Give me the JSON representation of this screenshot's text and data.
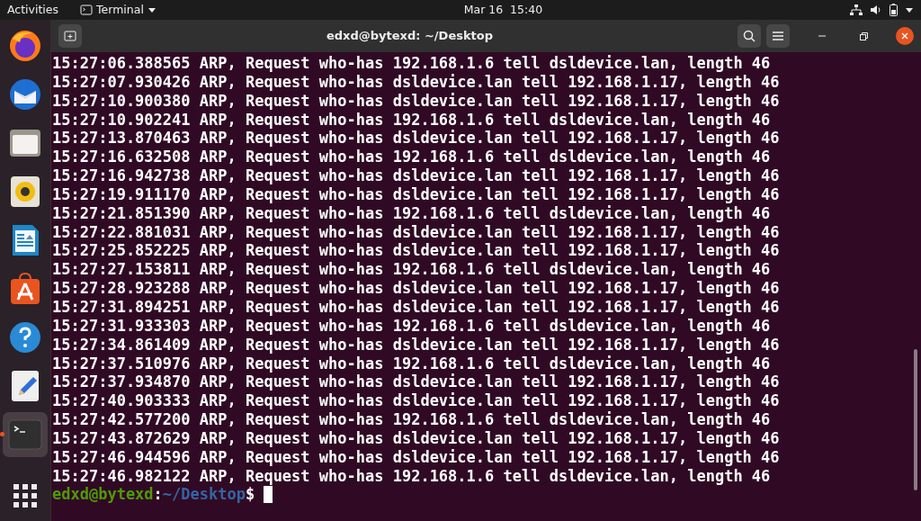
{
  "top_bar": {
    "activities": "Activities",
    "app_menu": "Terminal",
    "clock": "Mar 16  15:40"
  },
  "dock": {
    "items": [
      {
        "kind": "firefox",
        "selected": false,
        "running": false
      },
      {
        "kind": "mail",
        "selected": false,
        "running": false
      },
      {
        "kind": "files",
        "selected": false,
        "running": false
      },
      {
        "kind": "music",
        "selected": false,
        "running": false
      },
      {
        "kind": "document",
        "selected": false,
        "running": false
      },
      {
        "kind": "store",
        "selected": false,
        "running": false
      },
      {
        "kind": "help",
        "selected": false,
        "running": false
      },
      {
        "kind": "editor",
        "selected": false,
        "running": false
      },
      {
        "kind": "terminal",
        "selected": true,
        "running": true
      },
      {
        "kind": "grid",
        "selected": false,
        "running": false
      }
    ]
  },
  "window": {
    "title": "edxd@bytexd: ~/Desktop"
  },
  "terminal": {
    "lines": [
      "15:27:06.388565 ARP, Request who-has 192.168.1.6 tell dsldevice.lan, length 46",
      "15:27:07.930426 ARP, Request who-has dsldevice.lan tell 192.168.1.17, length 46",
      "15:27:10.900380 ARP, Request who-has dsldevice.lan tell 192.168.1.17, length 46",
      "15:27:10.902241 ARP, Request who-has 192.168.1.6 tell dsldevice.lan, length 46",
      "15:27:13.870463 ARP, Request who-has dsldevice.lan tell 192.168.1.17, length 46",
      "15:27:16.632508 ARP, Request who-has 192.168.1.6 tell dsldevice.lan, length 46",
      "15:27:16.942738 ARP, Request who-has dsldevice.lan tell 192.168.1.17, length 46",
      "15:27:19.911170 ARP, Request who-has dsldevice.lan tell 192.168.1.17, length 46",
      "15:27:21.851390 ARP, Request who-has 192.168.1.6 tell dsldevice.lan, length 46",
      "15:27:22.881031 ARP, Request who-has dsldevice.lan tell 192.168.1.17, length 46",
      "15:27:25.852225 ARP, Request who-has dsldevice.lan tell 192.168.1.17, length 46",
      "15:27:27.153811 ARP, Request who-has 192.168.1.6 tell dsldevice.lan, length 46",
      "15:27:28.923288 ARP, Request who-has dsldevice.lan tell 192.168.1.17, length 46",
      "15:27:31.894251 ARP, Request who-has dsldevice.lan tell 192.168.1.17, length 46",
      "15:27:31.933303 ARP, Request who-has 192.168.1.6 tell dsldevice.lan, length 46",
      "15:27:34.861409 ARP, Request who-has dsldevice.lan tell 192.168.1.17, length 46",
      "15:27:37.510976 ARP, Request who-has 192.168.1.6 tell dsldevice.lan, length 46",
      "15:27:37.934870 ARP, Request who-has dsldevice.lan tell 192.168.1.17, length 46",
      "15:27:40.903333 ARP, Request who-has dsldevice.lan tell 192.168.1.17, length 46",
      "15:27:42.577200 ARP, Request who-has 192.168.1.6 tell dsldevice.lan, length 46",
      "15:27:43.872629 ARP, Request who-has dsldevice.lan tell 192.168.1.17, length 46",
      "15:27:46.944596 ARP, Request who-has dsldevice.lan tell 192.168.1.17, length 46",
      "15:27:46.982122 ARP, Request who-has 192.168.1.6 tell dsldevice.lan, length 46"
    ],
    "prompt": [
      {
        "text": "edxd@bytexd",
        "kind": "user"
      },
      {
        "text": ":",
        "kind": "plain"
      },
      {
        "text": "~/Desktop",
        "kind": "path"
      },
      {
        "text": "$",
        "kind": "plain"
      }
    ]
  }
}
